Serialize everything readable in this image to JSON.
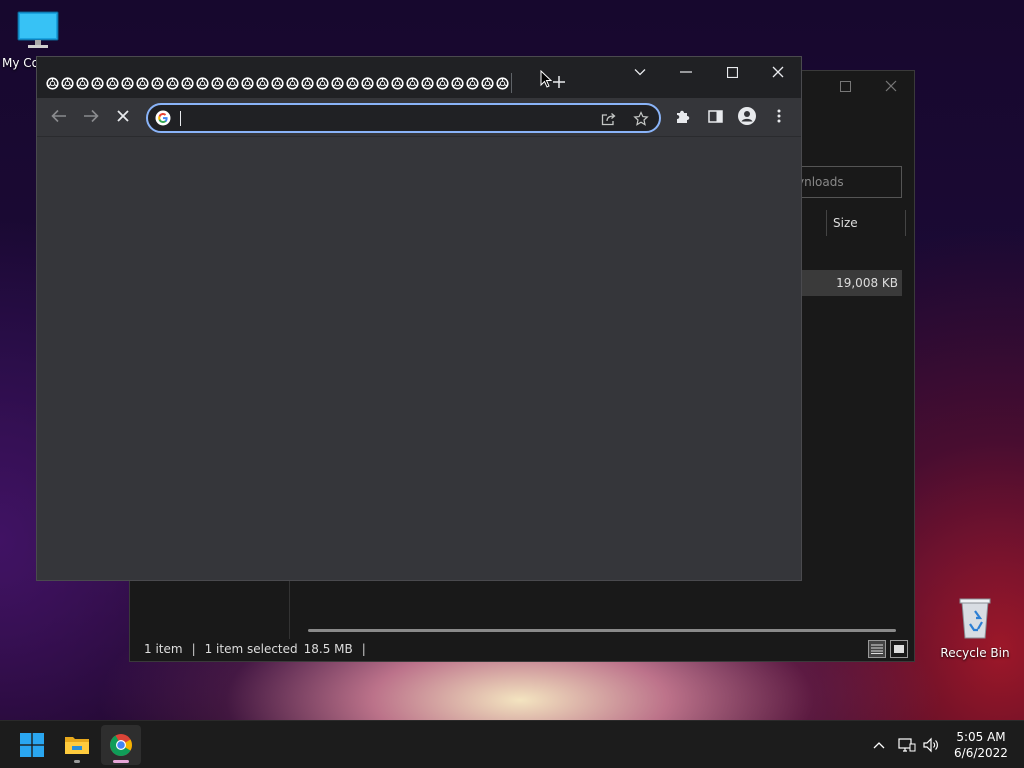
{
  "desktop": {
    "icons": [
      {
        "label": "My Co"
      },
      {
        "label": "Recycle Bin"
      }
    ]
  },
  "explorer": {
    "search_placeholder": "ynloads",
    "column_size": "Size",
    "file_size": "19,008 KB",
    "status": {
      "items": "1 item",
      "selected": "1 item selected",
      "size": "18.5 MB"
    }
  },
  "chrome": {
    "tab_count": 31,
    "tab_icon": "chrome-favicon",
    "omnibox": {
      "value": "",
      "placeholder": ""
    },
    "accent_color": "#8ab4f8"
  },
  "taskbar": {
    "time": "5:05 AM",
    "date": "6/6/2022",
    "apps": [
      "start",
      "file-explorer",
      "chrome"
    ]
  },
  "colors": {
    "chrome_frame": "#202124",
    "chrome_body": "#35363a",
    "taskbar": "#1c1c1c"
  }
}
